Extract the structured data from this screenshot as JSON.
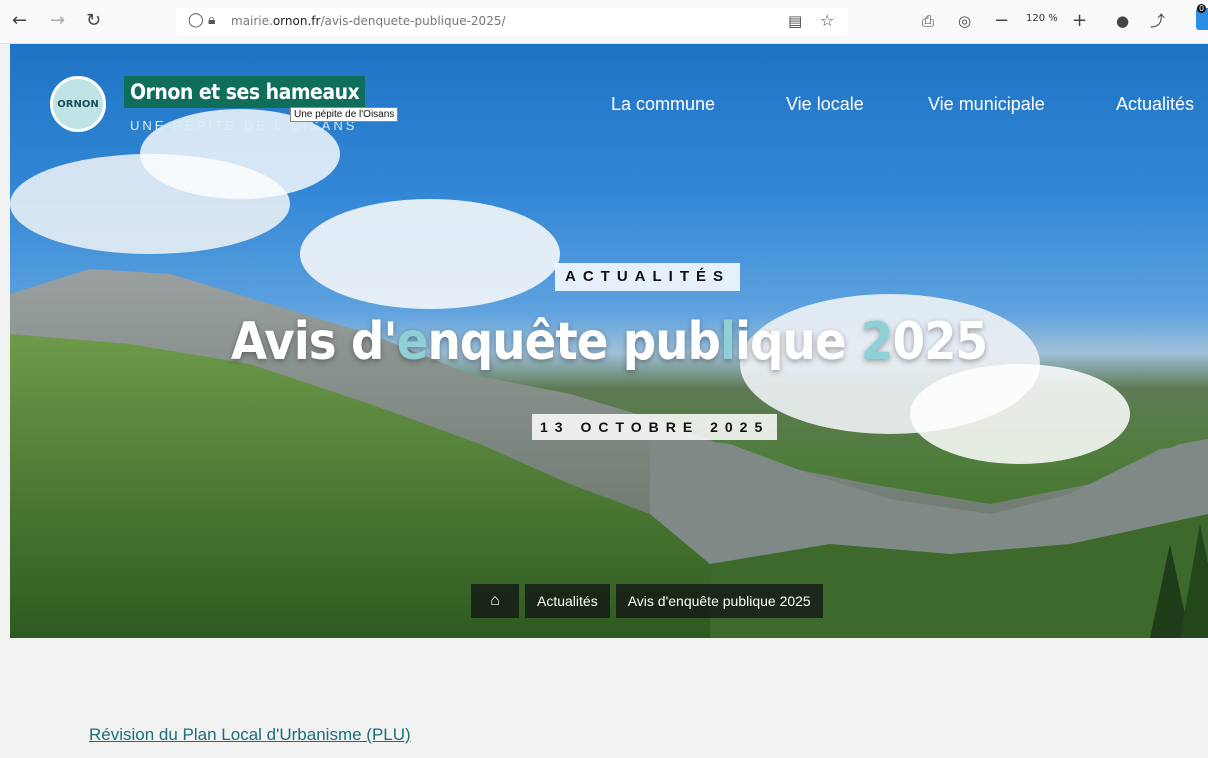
{
  "browser": {
    "url_prefix": "mairie.",
    "url_domain": "ornon.fr",
    "url_path": "/avis-denquete-publique-2025/",
    "zoom_label": "120 %",
    "ext_badge": "0"
  },
  "site": {
    "logo_text": "ORNON",
    "title": "Ornon et ses hameaux",
    "tagline": "UNE PÉPITE DE L'OISANS",
    "tooltip": "Une pépite de l'Oisans"
  },
  "nav": {
    "items": [
      "La commune",
      "Vie locale",
      "Vie municipale",
      "Actualités"
    ]
  },
  "hero": {
    "kicker": "ACTUALITÉS",
    "headline_parts": [
      "Avis d'",
      "e",
      "nquête pub",
      "l",
      "ique ",
      "2",
      "025"
    ],
    "date": "13 OCTOBRE 2025"
  },
  "breadcrumb": {
    "home_icon": "home-icon",
    "items": [
      "Actualités",
      "Avis d'enquête publique 2025"
    ]
  },
  "content": {
    "link": "Révision du Plan Local d'Urbanisme (PLU)"
  },
  "colors": {
    "brand": "#0f6e5a",
    "accent": "#8fd0d6",
    "link": "#1a6f78"
  }
}
